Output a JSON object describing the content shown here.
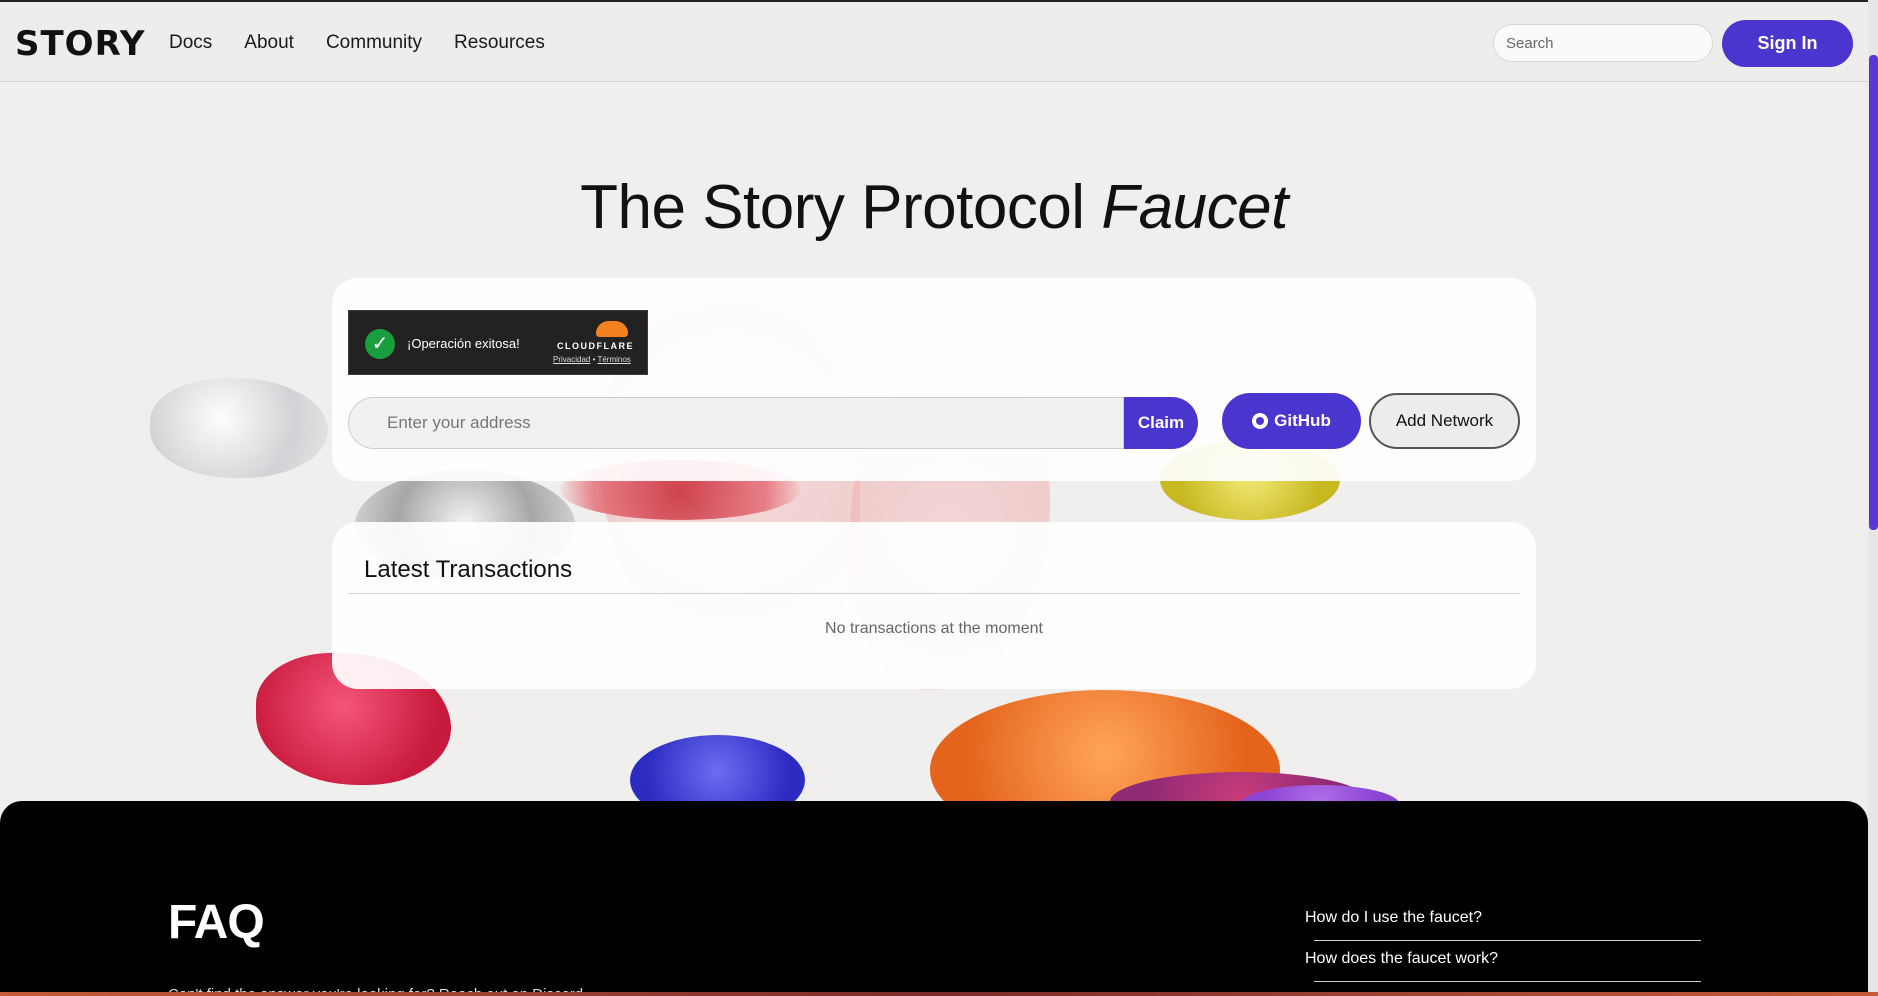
{
  "header": {
    "logo": "STORY",
    "nav": [
      "Docs",
      "About",
      "Community",
      "Resources"
    ],
    "search_placeholder": "Search",
    "signin_label": "Sign In"
  },
  "hero": {
    "title_main": "The Story Protocol ",
    "title_em": "Faucet"
  },
  "captcha": {
    "status": "¡Operación exitosa!",
    "brand": "CLOUDFLARE",
    "link_privacy": "Privacidad",
    "link_sep": " • ",
    "link_terms": "Términos"
  },
  "claim": {
    "address_placeholder": "Enter your address",
    "claim_label": "Claim",
    "github_label": "GitHub",
    "add_network_label": "Add Network"
  },
  "transactions": {
    "title": "Latest Transactions",
    "empty": "No transactions at the moment"
  },
  "faq": {
    "title": "FAQ",
    "subtitle": "Can't find the answer you're looking for? Reach out on Discord.",
    "items": [
      "How do I use the faucet?",
      "How does the faucet work?"
    ]
  }
}
